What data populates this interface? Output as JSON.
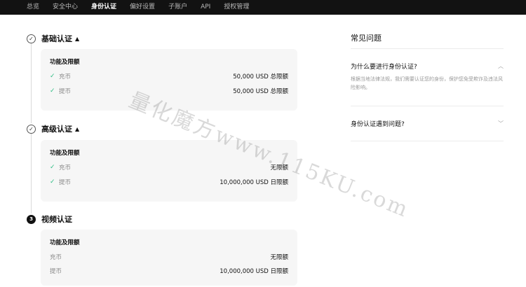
{
  "nav": {
    "items": [
      {
        "label": "总览"
      },
      {
        "label": "安全中心"
      },
      {
        "label": "身份认证",
        "active": true
      },
      {
        "label": "偏好设置"
      },
      {
        "label": "子账户"
      },
      {
        "label": "API"
      },
      {
        "label": "授权管理"
      }
    ]
  },
  "steps": [
    {
      "title": "基础认证",
      "status": "completed",
      "caret": "▲",
      "card_title": "功能及限额",
      "rows": [
        {
          "label": "充币",
          "value": "50,000 USD 总限额",
          "checked": true
        },
        {
          "label": "提币",
          "value": "50,000 USD 总限额",
          "checked": true
        }
      ]
    },
    {
      "title": "高级认证",
      "status": "completed",
      "caret": "▲",
      "card_title": "功能及限额",
      "rows": [
        {
          "label": "充币",
          "value": "无限额",
          "checked": true
        },
        {
          "label": "提币",
          "value": "10,000,000 USD 日限额",
          "checked": true
        }
      ]
    },
    {
      "title": "视频认证",
      "status": "pending",
      "number": "3",
      "card_title": "功能及限额",
      "rows": [
        {
          "label": "充币",
          "value": "无限额",
          "checked": false
        },
        {
          "label": "提币",
          "value": "10,000,000 USD 日限额",
          "checked": false
        }
      ]
    }
  ],
  "faq": {
    "title": "常见问题",
    "items": [
      {
        "question": "为什么要进行身份认证?",
        "answer": "根据当地法律法规，我们需要认证您的身份，保护您免受欺诈及违法风险影响。",
        "expanded": true
      },
      {
        "question": "身份认证遇到问题?",
        "expanded": false
      }
    ]
  },
  "watermark": "量化魔方www.115KU.com"
}
